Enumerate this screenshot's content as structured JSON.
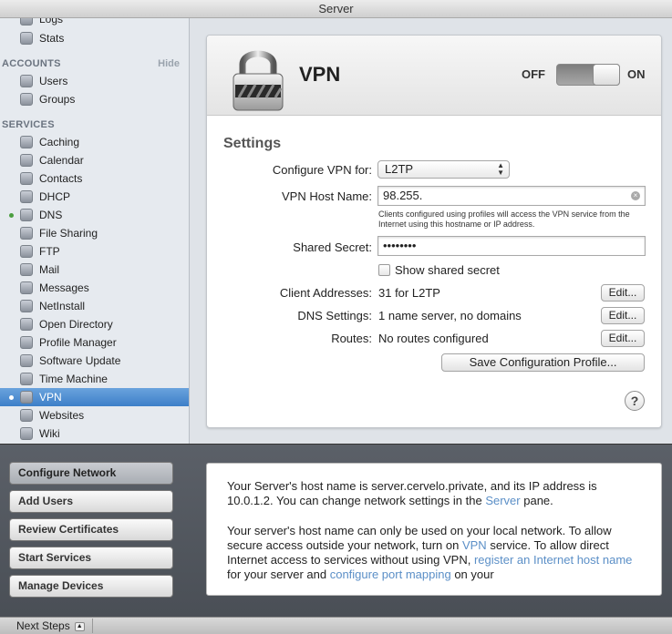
{
  "window": {
    "title": "Server"
  },
  "sidebar": {
    "top_items": [
      {
        "label": "Logs",
        "icon": "logs-icon"
      },
      {
        "label": "Stats",
        "icon": "stats-icon"
      }
    ],
    "accounts": {
      "heading": "ACCOUNTS",
      "hide_label": "Hide",
      "items": [
        {
          "label": "Users"
        },
        {
          "label": "Groups"
        }
      ]
    },
    "services": {
      "heading": "SERVICES",
      "items": [
        {
          "label": "Caching",
          "icon": "caching-icon",
          "running": false
        },
        {
          "label": "Calendar",
          "icon": "calendar-icon",
          "running": false
        },
        {
          "label": "Contacts",
          "icon": "contacts-icon",
          "running": false
        },
        {
          "label": "DHCP",
          "icon": "dhcp-icon",
          "running": false
        },
        {
          "label": "DNS",
          "icon": "dns-icon",
          "running": true
        },
        {
          "label": "File Sharing",
          "icon": "file-sharing-icon",
          "running": false
        },
        {
          "label": "FTP",
          "icon": "ftp-icon",
          "running": false
        },
        {
          "label": "Mail",
          "icon": "mail-icon",
          "running": false
        },
        {
          "label": "Messages",
          "icon": "messages-icon",
          "running": false
        },
        {
          "label": "NetInstall",
          "icon": "netinstall-icon",
          "running": false
        },
        {
          "label": "Open Directory",
          "icon": "open-directory-icon",
          "running": false
        },
        {
          "label": "Profile Manager",
          "icon": "profile-manager-icon",
          "running": false
        },
        {
          "label": "Software Update",
          "icon": "software-update-icon",
          "running": false
        },
        {
          "label": "Time Machine",
          "icon": "time-machine-icon",
          "running": false
        },
        {
          "label": "VPN",
          "icon": "vpn-icon",
          "running": true,
          "selected": true
        },
        {
          "label": "Websites",
          "icon": "websites-icon",
          "running": false
        },
        {
          "label": "Wiki",
          "icon": "wiki-icon",
          "running": false
        }
      ]
    }
  },
  "vpn": {
    "title": "VPN",
    "toggle": {
      "off_label": "OFF",
      "on_label": "ON",
      "state": "on"
    },
    "settings_heading": "Settings",
    "configure_label": "Configure VPN for:",
    "configure_value": "L2TP",
    "host_label": "VPN Host Name:",
    "host_value": "98.255.",
    "host_help": "Clients configured using profiles will access the VPN service from the Internet using this hostname or IP address.",
    "secret_label": "Shared Secret:",
    "secret_value": "••••••••",
    "show_secret_label": "Show shared secret",
    "client_label": "Client Addresses:",
    "client_value": "31 for L2TP",
    "dns_label": "DNS Settings:",
    "dns_value": "1 name server, no domains",
    "routes_label": "Routes:",
    "routes_value": "No routes configured",
    "edit_label": "Edit...",
    "save_profile_label": "Save Configuration Profile...",
    "help_label": "?"
  },
  "next_steps": {
    "buttons": [
      {
        "label": "Configure Network",
        "active": true
      },
      {
        "label": "Add Users",
        "active": false
      },
      {
        "label": "Review Certificates",
        "active": false
      },
      {
        "label": "Start Services",
        "active": false
      },
      {
        "label": "Manage Devices",
        "active": false
      }
    ],
    "info": {
      "p1_a": "Your Server's host name is server.cervelo.private, and its IP address is 10.0.1.2. You can change network settings in the ",
      "p1_link": "Server",
      "p1_b": " pane.",
      "p2_a": "Your server's host name can only be used on your local network. To allow secure access outside your network, turn on ",
      "p2_link1": "VPN",
      "p2_b": " service. To allow direct Internet access to services without using VPN, ",
      "p2_link2": "register an Internet host name",
      "p2_c": " for your server and ",
      "p2_link3": "configure port mapping",
      "p2_d": " on your"
    },
    "status_label": "Next Steps"
  }
}
